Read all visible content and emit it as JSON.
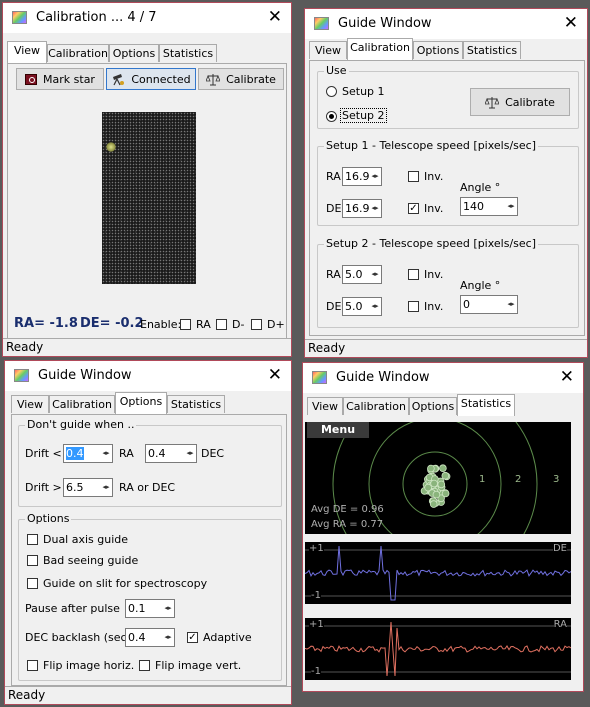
{
  "calib_win": {
    "title": "Calibration ... 4 / 7",
    "tabs": [
      "View",
      "Calibration",
      "Options",
      "Statistics"
    ],
    "buttons": {
      "mark_star": "Mark star",
      "connected": "Connected",
      "calibrate": "Calibrate"
    },
    "readout": {
      "ra": "RA= -1.8",
      "de": "DE= -0.2",
      "enable": "Enable:",
      "ra_chk": "RA",
      "dminus": "D-",
      "dplus": "D+"
    },
    "status": "Ready"
  },
  "guide_cal": {
    "title": "Guide Window",
    "tabs": [
      "View",
      "Calibration",
      "Options",
      "Statistics"
    ],
    "use_label": "Use",
    "setup1": "Setup 1",
    "setup2": "Setup 2",
    "calibrate": "Calibrate",
    "s1_title": "Setup 1  -  Telescope speed  [pixels/sec]",
    "s2_title": "Setup 2  -  Telescope speed  [pixels/sec]",
    "ra": "RA",
    "de": "DE",
    "inv": "Inv.",
    "angle": "Angle °",
    "s1_ra": "16.9",
    "s1_de": "16.9",
    "s1_angle": "140",
    "s2_ra": "5.0",
    "s2_de": "5.0",
    "s2_angle": "0",
    "status": "Ready"
  },
  "guide_opt": {
    "title": "Guide Window",
    "tabs": [
      "View",
      "Calibration",
      "Options",
      "Statistics"
    ],
    "dont_guide": "Don't guide when ..",
    "drift_lt": "Drift <",
    "drift_gt": "Drift >",
    "drift_ra": "0.4",
    "ra": "RA",
    "drift_dec": "0.4",
    "dec": "DEC",
    "drift_max": "6.5",
    "ra_or_dec": "RA or DEC",
    "options": "Options",
    "dual_axis": "Dual axis guide",
    "bad_seeing": "Bad seeing guide",
    "slit": "Guide on slit for spectroscopy",
    "pause": "Pause after pulse",
    "pause_val": "0.1",
    "backlash": "DEC backlash (sec)",
    "backlash_val": "0.4",
    "adaptive": "Adaptive",
    "flip_h": "Flip image horiz.",
    "flip_v": "Flip image vert.",
    "status": "Ready"
  },
  "guide_stat": {
    "title": "Guide Window",
    "tabs": [
      "View",
      "Calibration",
      "Options",
      "Statistics"
    ],
    "menu": "Menu",
    "rings": [
      "1",
      "2",
      "3"
    ],
    "avg_de": "Avg DE = 0.96",
    "avg_ra": "Avg RA = 0.77",
    "de_plus": "+1",
    "de_minus": "-1",
    "de_label": "DE",
    "ra_plus": "+1",
    "ra_minus": "-1",
    "ra_label": "RA"
  },
  "colors": {
    "de_trace": "#7070e0",
    "ra_trace": "#e07060",
    "window_border": "#b04a5a"
  }
}
